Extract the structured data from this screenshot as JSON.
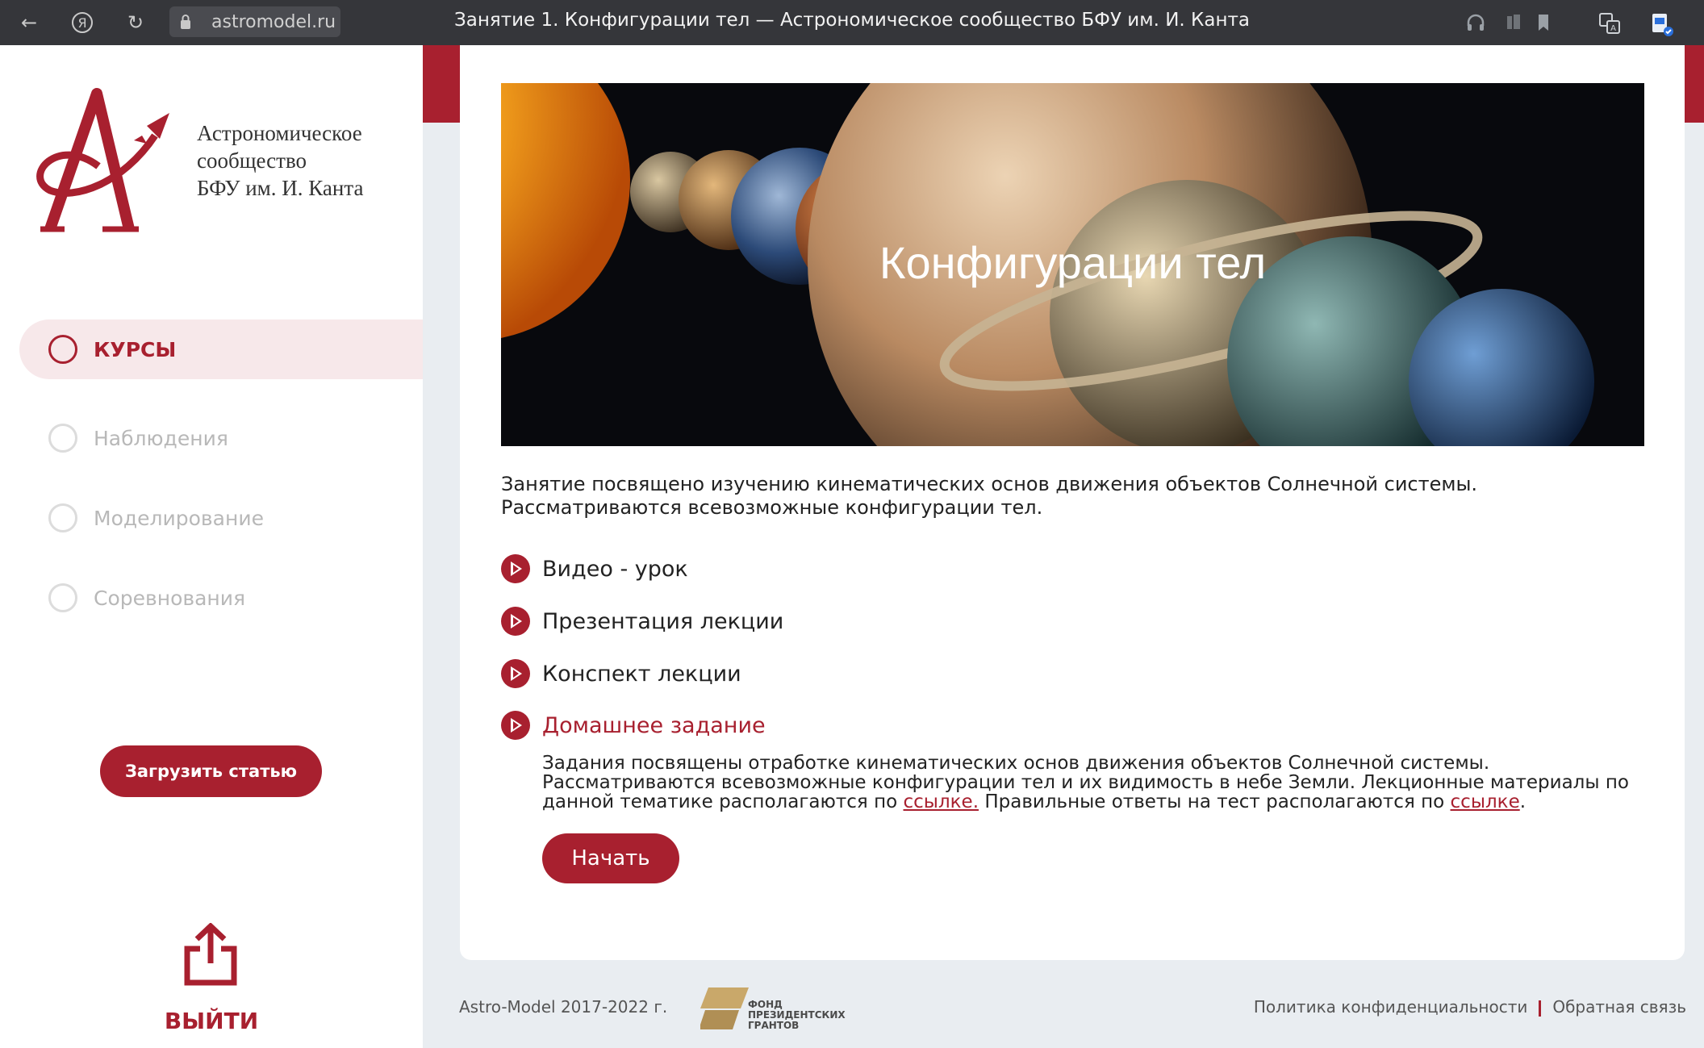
{
  "browser": {
    "url": "astromodel.ru",
    "title": "Занятие 1. Конфигурации тел — Астрономическое сообщество БФУ им. И. Канта"
  },
  "sidebar": {
    "logo_lines": [
      "Астрономическое",
      "сообщество",
      "БФУ им. И. Канта"
    ],
    "nav": [
      {
        "label": "Курсы",
        "active": true
      },
      {
        "label": "Наблюдения",
        "active": false
      },
      {
        "label": "Моделирование",
        "active": false
      },
      {
        "label": "Соревнования",
        "active": false
      }
    ],
    "upload_button": "Загрузить статью",
    "exit_label": "ВЫЙТИ"
  },
  "lesson": {
    "hero_title": "Конфигурации тел",
    "intro": "Занятие посвящено изучению кинематических основ движения объектов Солнечной системы. Рассматриваются всевозможные конфигурации тел.",
    "links": [
      "Видео - урок",
      "Презентация лекции",
      "Конспект лекции",
      "Домашнее задание"
    ],
    "homework": {
      "text_1": "Задания посвящены отработке кинематических основ движения объектов Солнечной системы. Рассматриваются всевозможные конфигурации тел и их видимость в небе Земли. Лекционные материалы по данной тематике располагаются по ",
      "link_1": "ссылке.",
      "text_2": " Правильные ответы на тест располагаются по ",
      "link_2": "ссылке",
      "text_3": ".",
      "start_button": "Начать"
    }
  },
  "footer": {
    "copyright": "Astro-Model 2017-2022 г.",
    "fund_lines": [
      "ФОНД",
      "ПРЕЗИДЕНТСКИХ",
      "ГРАНТОВ"
    ],
    "privacy": "Политика конфиденциальности",
    "feedback": "Обратная связь"
  },
  "colors": {
    "accent": "#a8202f",
    "page_bg": "#e9edf1",
    "active_nav_bg": "#f7e8ea"
  },
  "icons": [
    "back-icon",
    "yandex-icon",
    "reload-icon",
    "lock-icon",
    "headphones-icon",
    "reader-icon",
    "bookmark-icon",
    "translate-icon",
    "extension-icon",
    "play-icon",
    "exit-share-icon"
  ]
}
